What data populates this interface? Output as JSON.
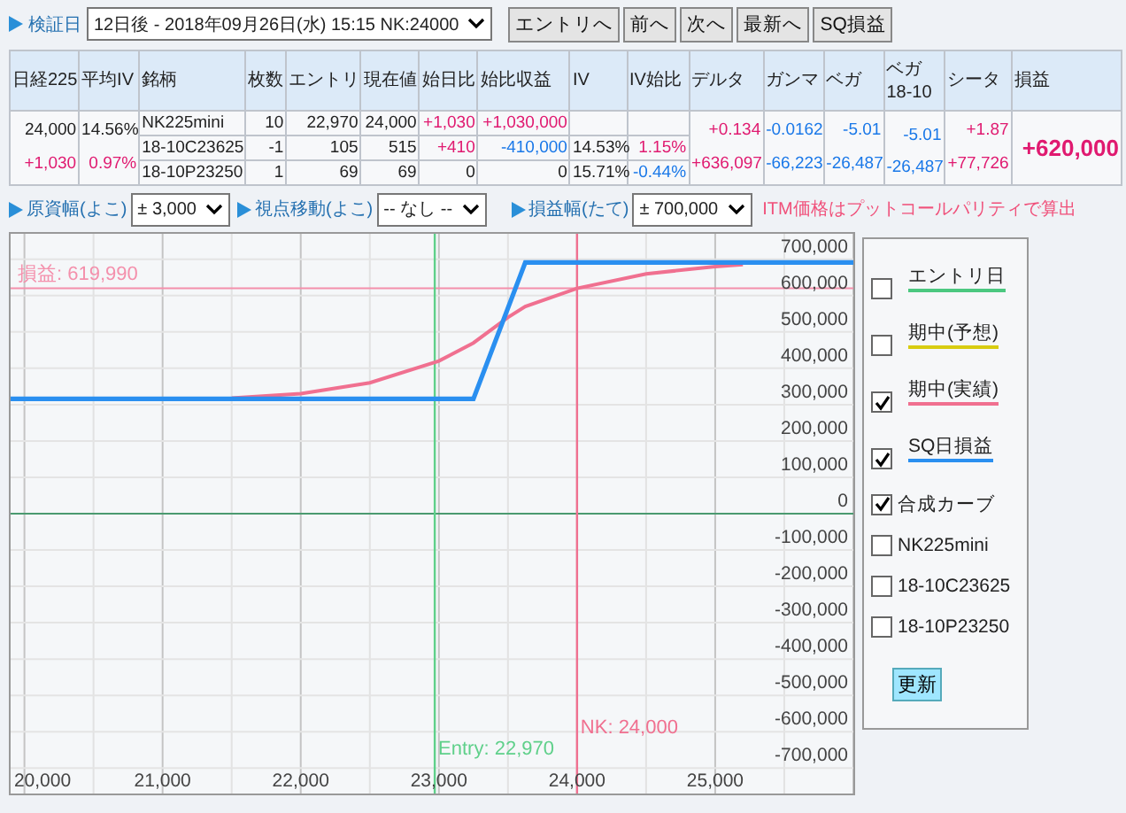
{
  "toolbar": {
    "date_label": "検証日",
    "date_select": "12日後 - 2018年09月26日(水) 15:15 NK:24000",
    "buttons": [
      "エントリへ",
      "前へ",
      "次へ",
      "最新へ",
      "SQ損益"
    ]
  },
  "table": {
    "columns": [
      "日経225",
      "平均IV",
      "銘柄",
      "枚数",
      "エントリ",
      "現在値",
      "始日比",
      "始比収益",
      "IV",
      "IV始比",
      "デルタ",
      "ガンマ",
      "ベガ",
      "ベガ\n18-10",
      "シータ",
      "損益"
    ],
    "summary": {
      "nikkei": "24,000",
      "nikkei_change": "+1,030",
      "avg_iv": "14.56%",
      "avg_iv_change": "0.97%",
      "delta": "+0.134",
      "delta_value": "+636,097",
      "gamma": "-0.0162",
      "gamma_value": "-66,223",
      "vega": "-5.01",
      "vega_value": "-26,487",
      "vega_1810": "-5.01",
      "vega_1810_value": "-26,487",
      "theta": "+1.87",
      "theta_value": "+77,726",
      "pnl": "+620,000"
    },
    "rows": [
      {
        "name": "NK225mini",
        "qty": "10",
        "entry": "22,970",
        "price": "24,000",
        "change": "+1,030",
        "pnl": "+1,030,000"
      },
      {
        "name": "18-10C23625",
        "qty": "-1",
        "entry": "105",
        "price": "515",
        "change": "+410",
        "pnl": "-410,000",
        "iv": "14.53%",
        "iv_change": "1.15%"
      },
      {
        "name": "18-10P23250",
        "qty": "1",
        "entry": "69",
        "price": "69",
        "change": "0",
        "pnl": "0",
        "iv": "15.71%",
        "iv_change": "-0.44%"
      }
    ]
  },
  "controls": [
    {
      "label": "原資幅(よこ)",
      "value": "± 3,000"
    },
    {
      "label": "視点移動(よこ)",
      "value": "-- なし --"
    },
    {
      "label": "損益幅(たて)",
      "value": "± 700,000"
    }
  ],
  "note": "ITM価格はプットコールパリティで算出",
  "chart": {
    "chart_data": {
      "type": "line",
      "grid": true,
      "x": [
        19900,
        21500,
        22000,
        22500,
        23000,
        23250,
        23500,
        23625,
        24000,
        24500,
        25000,
        25200,
        26000
      ],
      "series": [
        {
          "name": "期中(実績)",
          "color": "#f07090",
          "values": [
            null,
            318000,
            330000,
            360000,
            420000,
            470000,
            540000,
            570000,
            620000,
            660000,
            680000,
            685000,
            null
          ]
        },
        {
          "name": "SQ日損益",
          "color": "#2a8ff0",
          "values": [
            316000,
            316000,
            316000,
            316000,
            316000,
            316000,
            566000,
            691000,
            691000,
            691000,
            691000,
            691000,
            691000
          ]
        }
      ],
      "xlim": [
        19900,
        26000
      ],
      "ylim": [
        -770000,
        770000
      ],
      "xticks": [
        {
          "value": 20000,
          "label": "20,000"
        },
        {
          "value": 21000,
          "label": "21,000"
        },
        {
          "value": 22000,
          "label": "22,000"
        },
        {
          "value": 23000,
          "label": "23,000"
        },
        {
          "value": 24000,
          "label": "24,000"
        },
        {
          "value": 25000,
          "label": "25,000"
        }
      ],
      "yticks": [
        {
          "value": 700000,
          "label": "700,000"
        },
        {
          "value": 600000,
          "label": "600,000"
        },
        {
          "value": 500000,
          "label": "500,000"
        },
        {
          "value": 400000,
          "label": "400,000"
        },
        {
          "value": 300000,
          "label": "300,000"
        },
        {
          "value": 200000,
          "label": "200,000"
        },
        {
          "value": 100000,
          "label": "100,000"
        },
        {
          "value": 0,
          "label": "0"
        },
        {
          "value": -100000,
          "label": "-100,000"
        },
        {
          "value": -200000,
          "label": "-200,000"
        },
        {
          "value": -300000,
          "label": "-300,000"
        },
        {
          "value": -400000,
          "label": "-400,000"
        },
        {
          "value": -500000,
          "label": "-500,000"
        },
        {
          "value": -600000,
          "label": "-600,000"
        },
        {
          "value": -700000,
          "label": "-700,000"
        }
      ],
      "ref_lines": [
        {
          "axis": "y",
          "value": 619990,
          "label": "損益: 619,990",
          "color": "#f490ac"
        },
        {
          "axis": "y",
          "value": 0,
          "color": "#4a9a70"
        },
        {
          "axis": "x",
          "value": 22970,
          "label": "Entry: 22,970",
          "color": "#5fd08a"
        },
        {
          "axis": "x",
          "value": 24000,
          "label": "NK: 24,000",
          "color": "#f07090"
        }
      ]
    }
  },
  "legend": {
    "items": [
      {
        "kind": "curve",
        "label": "エントリ日",
        "checked": false,
        "color": "#4cc880"
      },
      {
        "kind": "curve",
        "label": "期中(予想)",
        "checked": false,
        "color": "#d8cc10"
      },
      {
        "kind": "series",
        "checked": true
      },
      {
        "kind": "series",
        "checked": true
      },
      {
        "kind": "plain",
        "label": "合成カーブ",
        "checked": true
      },
      {
        "kind": "plain",
        "label": "NK225mini",
        "checked": false
      },
      {
        "kind": "plain",
        "label": "18-10C23625",
        "checked": false
      },
      {
        "kind": "plain",
        "label": "18-10P23250",
        "checked": false
      }
    ],
    "button": "更新"
  }
}
